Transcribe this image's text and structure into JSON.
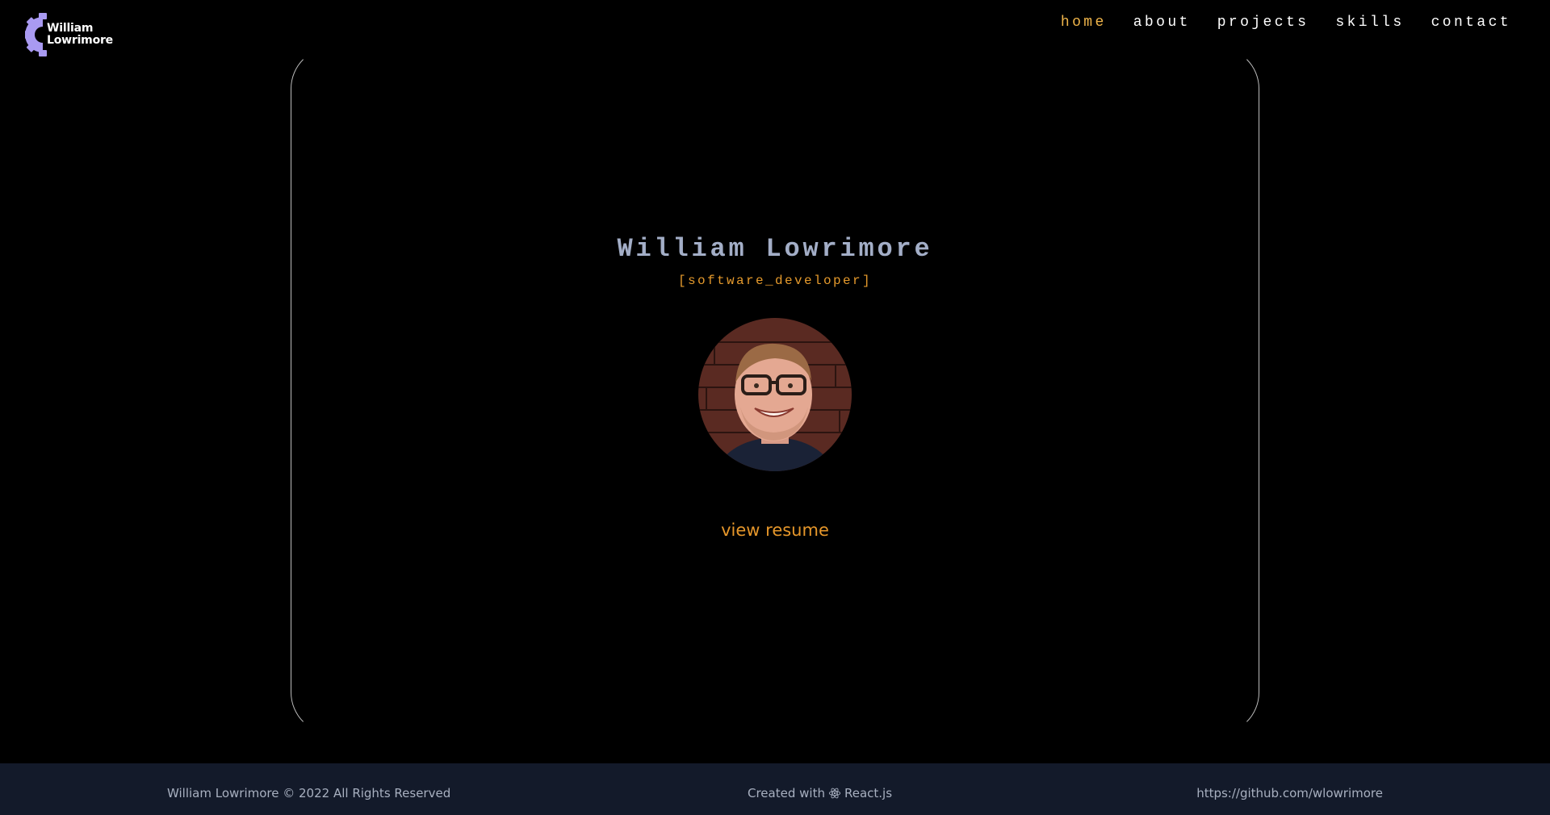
{
  "header": {
    "logo": {
      "line1": "William",
      "line2": "Lowrimore",
      "icon": "gear-icon",
      "accent_color": "#a99af1"
    },
    "nav": [
      {
        "label": "home",
        "active": true
      },
      {
        "label": "about",
        "active": false
      },
      {
        "label": "projects",
        "active": false
      },
      {
        "label": "skills",
        "active": false
      },
      {
        "label": "contact",
        "active": false
      }
    ]
  },
  "hero": {
    "name": "William Lowrimore",
    "role": "[software_developer]",
    "resume_label": "view resume"
  },
  "footer": {
    "copyright": "William Lowrimore © 2022 All Rights Reserved",
    "created_prefix": "Created with",
    "created_icon": "react-icon",
    "created_tech": "React.js",
    "github": "https://github.com/wlowrimore"
  },
  "colors": {
    "background": "#000000",
    "accent": "#e5962a",
    "nav_active": "#f0b54a",
    "name": "#a3aec7",
    "footer_bg": "#131a2a"
  }
}
